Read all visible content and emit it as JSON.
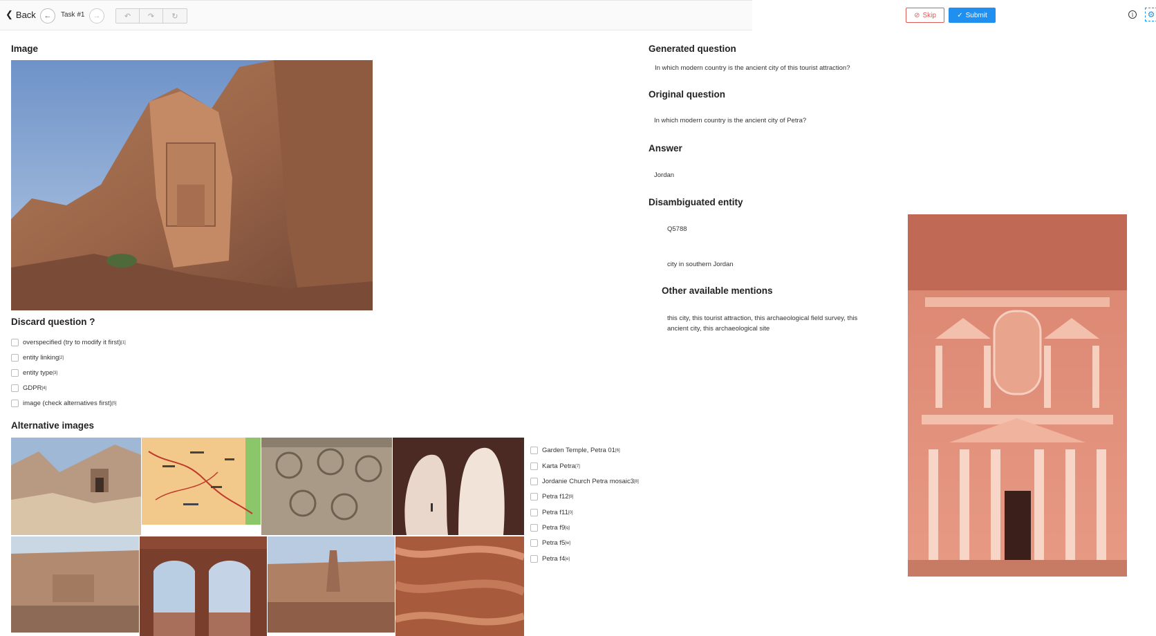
{
  "toolbar": {
    "back_label": "Back",
    "task_label": "Task #1",
    "skip_label": "Skip",
    "submit_label": "Submit",
    "accent_color": "#1f8ff0",
    "skip_color": "#e15858"
  },
  "image_section": {
    "heading": "Image"
  },
  "discard": {
    "heading": "Discard question ?",
    "options": [
      {
        "label": "overspecified (try to modify it first)",
        "sup": "[1]"
      },
      {
        "label": "entity linking",
        "sup": "[2]"
      },
      {
        "label": "entity type",
        "sup": "[3]"
      },
      {
        "label": "GDPR",
        "sup": "[4]"
      },
      {
        "label": "image (check alternatives first)",
        "sup": "[5]"
      }
    ]
  },
  "alternatives": {
    "heading": "Alternative images",
    "options": [
      {
        "label": "Garden Temple, Petra 01",
        "sup": "[6]"
      },
      {
        "label": "Karta Petra",
        "sup": "[7]"
      },
      {
        "label": "Jordanie Church Petra mosaic3",
        "sup": "[8]"
      },
      {
        "label": "Petra f12",
        "sup": "[9]"
      },
      {
        "label": "Petra f11",
        "sup": "[0]"
      },
      {
        "label": "Petra f9",
        "sup": "[q]"
      },
      {
        "label": "Petra f5",
        "sup": "[w]"
      },
      {
        "label": "Petra f4",
        "sup": "[e]"
      }
    ]
  },
  "generated": {
    "heading": "Generated question",
    "text": "In which modern country is the ancient city of this tourist attraction?"
  },
  "original": {
    "heading": "Original question",
    "text": "In which modern country is the ancient city of Petra?"
  },
  "answer": {
    "heading": "Answer",
    "text": "Jordan"
  },
  "entity": {
    "heading": "Disambiguated entity",
    "id": "Q5788",
    "description": "city in southern Jordan"
  },
  "mentions": {
    "heading": "Other available mentions",
    "text": "this city, this tourist attraction, this archaeological field survey, this ancient city, this archaeological site"
  }
}
